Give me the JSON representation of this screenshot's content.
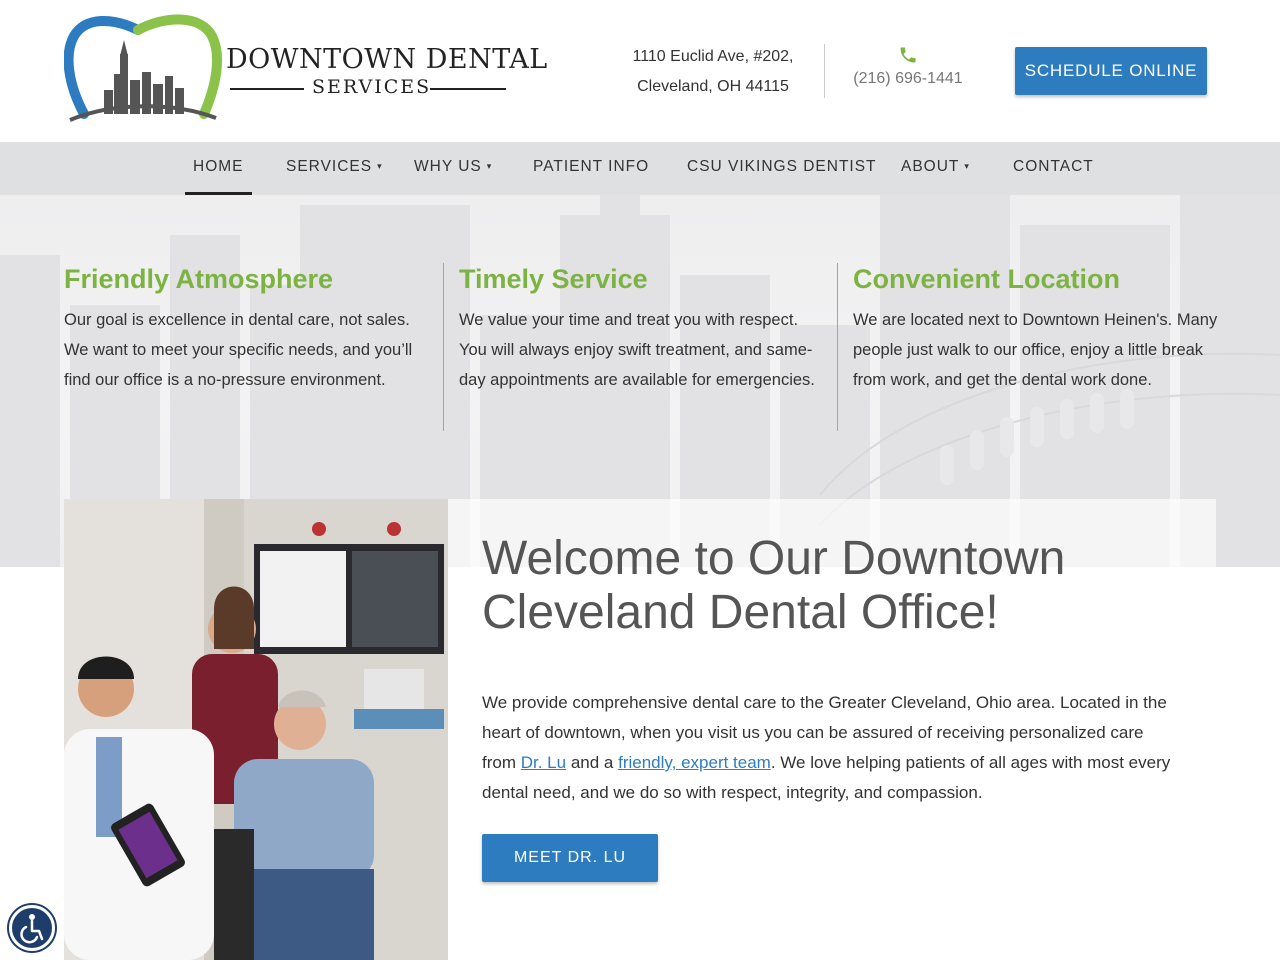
{
  "brand": {
    "name_line1": "DOWNTOWN DENTAL",
    "name_line2": "SERVICES",
    "colors": {
      "blue": "#2d7cc0",
      "green": "#7cb342",
      "navy": "#1f3d6b"
    }
  },
  "header": {
    "address_line1": "1110 Euclid Ave, #202,",
    "address_line2": "Cleveland, OH 44115",
    "phone": "(216) 696-1441",
    "phone_icon": "phone-icon",
    "schedule_label": "SCHEDULE ONLINE"
  },
  "nav": {
    "items": [
      {
        "label": "HOME",
        "active": true,
        "dropdown": false
      },
      {
        "label": "SERVICES",
        "active": false,
        "dropdown": true
      },
      {
        "label": "WHY US",
        "active": false,
        "dropdown": true
      },
      {
        "label": "PATIENT INFO",
        "active": false,
        "dropdown": false
      },
      {
        "label": "CSU VIKINGS DENTIST",
        "active": false,
        "dropdown": false
      },
      {
        "label": "ABOUT",
        "active": false,
        "dropdown": true
      },
      {
        "label": "CONTACT",
        "active": false,
        "dropdown": false
      }
    ],
    "caret": "▾"
  },
  "features": [
    {
      "title": "Friendly Atmosphere",
      "text": "Our goal is excellence in dental care, not sales. We want to meet your specific needs, and you’ll find our office is a no-pressure environment."
    },
    {
      "title": "Timely Service",
      "text": "We value your time and treat you with respect. You will always enjoy swift treatment, and same-day appointments are available for emergencies."
    },
    {
      "title": "Convenient Location",
      "text": "We are located next to Downtown Heinen's. Many people just walk to our office, enjoy a little break from work, and get the dental work done."
    }
  ],
  "welcome": {
    "title_line1": "Welcome to Our Downtown",
    "title_line2": "Cleveland Dental Office!",
    "text_part1": "We provide comprehensive dental care to the Greater Cleveland, Ohio area. Located in the heart of downtown, when you visit us you can be assured of receiving personalized care from ",
    "link1": "Dr. Lu",
    "text_part2": " and a ",
    "link2": "friendly, expert team",
    "text_part3": ". We love helping patients of all ages with most every dental need, and we do so with respect, integrity, and compassion.",
    "button": "MEET DR. LU"
  },
  "accessibility": {
    "icon": "accessibility-icon"
  }
}
